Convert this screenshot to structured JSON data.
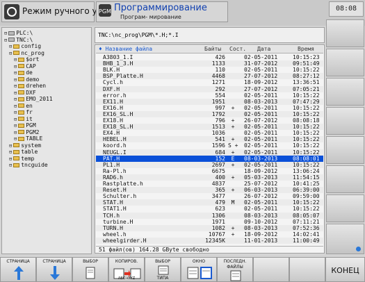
{
  "header": {
    "mode_left": "Режим ручного упра...",
    "mode_right_title": "Программирование",
    "mode_right_sub": "Програм- мирование",
    "clock": "08:08"
  },
  "tree": [
    {
      "label": "PLC:\\",
      "indent": 0,
      "folder": false
    },
    {
      "label": "TNC:\\",
      "indent": 0,
      "folder": false
    },
    {
      "label": "config",
      "indent": 1,
      "folder": true
    },
    {
      "label": "nc_prog",
      "indent": 1,
      "folder": true
    },
    {
      "label": "$ort",
      "indent": 2,
      "folder": true
    },
    {
      "label": "CAP",
      "indent": 2,
      "folder": true
    },
    {
      "label": "de",
      "indent": 2,
      "folder": true
    },
    {
      "label": "demo",
      "indent": 2,
      "folder": true
    },
    {
      "label": "drehen",
      "indent": 2,
      "folder": true
    },
    {
      "label": "DXF",
      "indent": 2,
      "folder": true
    },
    {
      "label": "EMO_2011",
      "indent": 2,
      "folder": true
    },
    {
      "label": "en",
      "indent": 2,
      "folder": true
    },
    {
      "label": "fr",
      "indent": 2,
      "folder": true
    },
    {
      "label": "it",
      "indent": 2,
      "folder": true
    },
    {
      "label": "PGM",
      "indent": 2,
      "folder": true
    },
    {
      "label": "PGM2",
      "indent": 2,
      "folder": true
    },
    {
      "label": "TABLE",
      "indent": 2,
      "folder": true
    },
    {
      "label": "system",
      "indent": 1,
      "folder": true
    },
    {
      "label": "table",
      "indent": 1,
      "folder": true
    },
    {
      "label": "temp",
      "indent": 1,
      "folder": true
    },
    {
      "label": "tncguide",
      "indent": 1,
      "folder": true
    }
  ],
  "path": "TNC:\\nc_prog\\PGM\\*.H;*.I",
  "columns": {
    "name": "♦ Название файла",
    "size": "Байты",
    "status": "Сост.",
    "date": "Дата",
    "time": "Время"
  },
  "files": [
    {
      "name": "A3803_1.I",
      "size": "426",
      "status": "",
      "date": "02-05-2011",
      "time": "10:15:23"
    },
    {
      "name": "BHB_1_3.H",
      "size": "1133",
      "status": "",
      "date": "31-07-2012",
      "time": "09:51:49"
    },
    {
      "name": "BLK.H",
      "size": "110",
      "status": "",
      "date": "02-05-2011",
      "time": "10:15:22"
    },
    {
      "name": "BSP_Platte.H",
      "size": "4468",
      "status": "",
      "date": "27-07-2012",
      "time": "08:27:12"
    },
    {
      "name": "Cycl.h",
      "size": "1271",
      "status": "",
      "date": "18-09-2012",
      "time": "13:36:51"
    },
    {
      "name": "DXF.H",
      "size": "292",
      "status": "",
      "date": "27-07-2012",
      "time": "07:05:21"
    },
    {
      "name": "error.h",
      "size": "554",
      "status": "",
      "date": "02-05-2011",
      "time": "10:15:22"
    },
    {
      "name": "EX11.H",
      "size": "1951",
      "status": "",
      "date": "08-03-2013",
      "time": "07:47:29"
    },
    {
      "name": "EX16.H",
      "size": "997",
      "status": "+",
      "date": "02-05-2011",
      "time": "10:15:22"
    },
    {
      "name": "EX16_SL.H",
      "size": "1792",
      "status": "",
      "date": "02-05-2011",
      "time": "10:15:22"
    },
    {
      "name": "EX18.H",
      "size": "796",
      "status": "+",
      "date": "26-07-2012",
      "time": "08:08:18"
    },
    {
      "name": "EX18_SL.H",
      "size": "1513",
      "status": "+",
      "date": "02-05-2011",
      "time": "10:15:22"
    },
    {
      "name": "EX4.H",
      "size": "1036",
      "status": "",
      "date": "02-05-2011",
      "time": "10:15:22"
    },
    {
      "name": "HEBEL.H",
      "size": "541",
      "status": "+",
      "date": "02-05-2011",
      "time": "10:15:22"
    },
    {
      "name": "koord.h",
      "size": "1596",
      "status": "S +",
      "date": "02-05-2011",
      "time": "10:15:22"
    },
    {
      "name": "NEUGL.I",
      "size": "684",
      "status": "+",
      "date": "02-05-2011",
      "time": "10:15:22"
    },
    {
      "name": "PAT.H",
      "size": "152",
      "status": "E",
      "date": "08-03-2013",
      "time": "08:08:01",
      "selected": true
    },
    {
      "name": "PL1.H",
      "size": "2697",
      "status": "+",
      "date": "02-05-2011",
      "time": "10:15:22"
    },
    {
      "name": "Ra-Pl.h",
      "size": "6675",
      "status": "",
      "date": "18-09-2012",
      "time": "13:06:24"
    },
    {
      "name": "RAD6.h",
      "size": "400",
      "status": "+",
      "date": "05-03-2013",
      "time": "11:54:15"
    },
    {
      "name": "Rastplatte.h",
      "size": "4837",
      "status": "",
      "date": "25-07-2012",
      "time": "10:41:25"
    },
    {
      "name": "Reset.H",
      "size": "365",
      "status": "+",
      "date": "06-03-2013",
      "time": "06:39:00"
    },
    {
      "name": "Schulter.h",
      "size": "3477",
      "status": "",
      "date": "26-07-2012",
      "time": "09:59:00"
    },
    {
      "name": "STAT.H",
      "size": "479",
      "status": "M",
      "date": "02-05-2011",
      "time": "10:15:22"
    },
    {
      "name": "STAT1.H",
      "size": "623",
      "status": "",
      "date": "02-05-2011",
      "time": "10:15:22"
    },
    {
      "name": "TCH.h",
      "size": "1306",
      "status": "",
      "date": "08-03-2013",
      "time": "08:05:07"
    },
    {
      "name": "turbine.H",
      "size": "1971",
      "status": "",
      "date": "09-10-2012",
      "time": "07:11:21"
    },
    {
      "name": "TURN.H",
      "size": "1082",
      "status": "+",
      "date": "08-03-2013",
      "time": "07:52:36"
    },
    {
      "name": "wheel.h",
      "size": "10767",
      "status": "+",
      "date": "18-09-2012",
      "time": "14:02:41"
    },
    {
      "name": "wheelgirder.H",
      "size": "12345K",
      "status": "",
      "date": "11-01-2013",
      "time": "11:00:49"
    }
  ],
  "footer": "51  файл(ов) 164.28 GByte свободно",
  "softkeys": [
    {
      "label": "СТРАНИЦА",
      "icon": "arrow-up-icon"
    },
    {
      "label": "СТРАНИЦА",
      "icon": "arrow-down-icon"
    },
    {
      "label": "ВЫБОР",
      "icon": "select-file-icon"
    },
    {
      "label": "КОПИРОВ.",
      "label2": "ABC→XYZ",
      "icon": "copy-icon"
    },
    {
      "label": "ВЫБОР",
      "label2": "ТИПА",
      "icon": "select-type-icon"
    },
    {
      "label": "ОКНО",
      "icon": "window-icon"
    },
    {
      "label": "ПОСЛЕДН.",
      "label2": "ФАЙЛЫ",
      "icon": "recent-files-icon"
    },
    {
      "label": "",
      "icon": ""
    },
    {
      "label": "",
      "icon": ""
    },
    {
      "label": "КОНЕЦ",
      "icon": ""
    }
  ],
  "colors": {
    "selection": "#0a50d8",
    "accent_orange": "#f0a020",
    "arrow_blue": "#2a78d8"
  }
}
